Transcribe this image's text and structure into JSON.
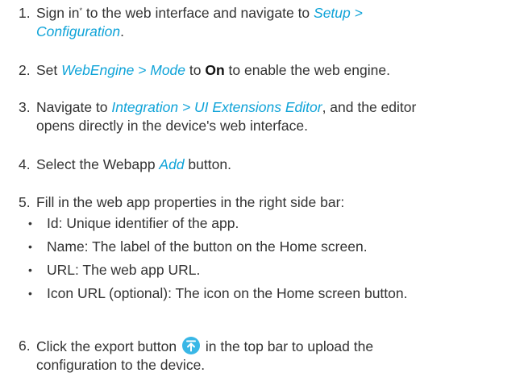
{
  "steps": [
    {
      "num": "1.",
      "t1": "Sign in",
      "sup": "*",
      "t2": " to the web interface and navigate to ",
      "e1": "Setup >",
      "e2": "Configuration",
      "t3": "."
    },
    {
      "num": "2.",
      "t1": "Set ",
      "e1": "WebEngine > Mode",
      "t2": " to ",
      "s1": "On",
      "t3": " to enable the web engine."
    },
    {
      "num": "3.",
      "t1": "Navigate to ",
      "e1": "Integration > UI Extensions Editor",
      "t2": ", and the editor",
      "t3": "opens directly in the device's web interface."
    },
    {
      "num": "4.",
      "t1": "Select the Webapp ",
      "e1": "Add",
      "t2": " button."
    },
    {
      "num": "5.",
      "t1": "Fill in the web app properties in the right side bar:"
    },
    {
      "num": "6.",
      "t1": "Click the export button",
      "t2": "in the top bar to upload the",
      "t3": "configuration to the device."
    }
  ],
  "bullets": [
    {
      "dot": "•",
      "text": "Id: Unique identifier of the app."
    },
    {
      "dot": "•",
      "text": "Name: The label of the button on the Home screen."
    },
    {
      "dot": "•",
      "text": "URL: The web app URL."
    },
    {
      "dot": "•",
      "text": "Icon URL (optional): The icon on the Home screen button."
    }
  ],
  "icons": {
    "export": "export-icon"
  },
  "colors": {
    "link": "#0fa3d8",
    "export_icon": "#39b7e6",
    "text": "#333333"
  }
}
